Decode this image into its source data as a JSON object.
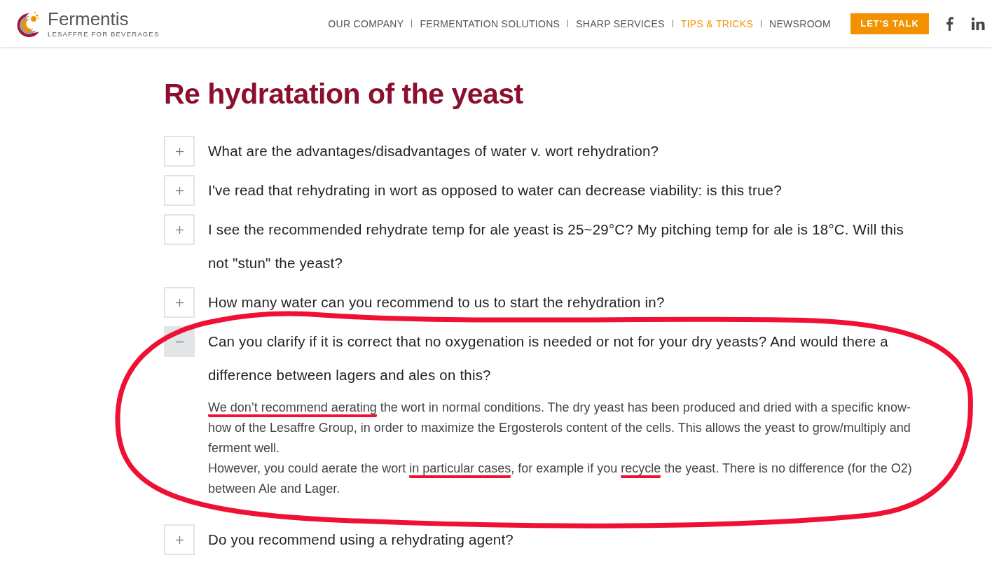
{
  "header": {
    "logo": {
      "name": "Fermentis",
      "tagline": "LESAFFRE FOR BEVERAGES"
    },
    "nav": [
      {
        "label": "OUR COMPANY",
        "selected": false
      },
      {
        "label": "FERMENTATION SOLUTIONS",
        "selected": false
      },
      {
        "label": "SHARP SERVICES",
        "selected": false
      },
      {
        "label": "TIPS & TRICKS",
        "selected": true
      },
      {
        "label": "NEWSROOM",
        "selected": false
      }
    ],
    "cta": "LET'S TALK",
    "social": [
      {
        "kind": "facebook"
      },
      {
        "kind": "linkedin"
      }
    ]
  },
  "title": "Re hydratation of the yeast",
  "faq": [
    {
      "question": "What are the advantages/disadvantages of water v. wort rehydration?",
      "expanded": false
    },
    {
      "question": "I've read that rehydrating in wort as opposed to water can decrease viability: is this true?",
      "expanded": false
    },
    {
      "question": "I see the recommended rehydrate temp for ale yeast is 25~29°C? My pitching temp for ale is 18°C. Will this not \"stun\" the yeast?",
      "expanded": false
    },
    {
      "question": "How many water can you recommend to us to start the rehydration in?",
      "expanded": false
    },
    {
      "question": "Can you clarify if it is correct that no oxygenation is needed or not for your dry yeasts? And would there a difference between lagers and ales on this?",
      "expanded": true,
      "annotated": true,
      "answer": [
        [
          {
            "text": "We don’t recommend aerating",
            "marked": true
          },
          {
            "text": " the wort in normal conditions. The dry yeast has been produced and dried with a specific know-how of the Lesaffre Group, in order to maximize the Ergosterols content of the cells. This allows the yeast to grow/multiply and ferment well.",
            "marked": false
          }
        ],
        [
          {
            "text": "However, you could aerate the wort ",
            "marked": false
          },
          {
            "text": "in particular cases",
            "marked": true
          },
          {
            "text": ", for example if you ",
            "marked": false
          },
          {
            "text": "recycle",
            "marked": true
          },
          {
            "text": " the yeast. There is no difference (for the O2) between Ale and Lager.",
            "marked": false
          }
        ]
      ]
    },
    {
      "question": "Do you recommend using a rehydrating agent?",
      "expanded": false
    }
  ]
}
